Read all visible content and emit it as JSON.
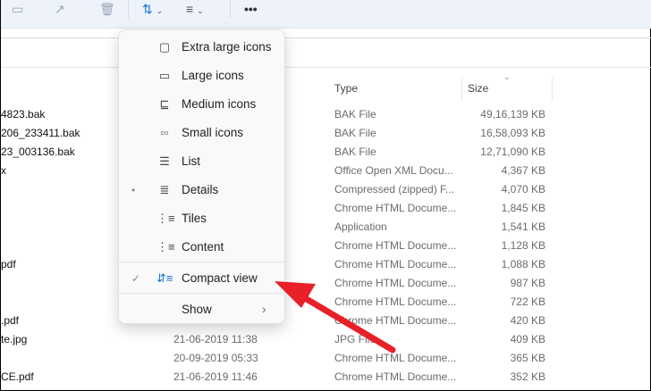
{
  "toolbar": {
    "sort_icon": "sort-icon",
    "view_icon": "view-icon",
    "more_label": "•••"
  },
  "columns": {
    "type": "Type",
    "size": "Size"
  },
  "rows": [
    {
      "name": "4823.bak",
      "date": "",
      "type": "BAK File",
      "size": "49,16,139 KB"
    },
    {
      "name": "206_233411.bak",
      "date": "",
      "type": "BAK File",
      "size": "16,58,093 KB"
    },
    {
      "name": "23_003136.bak",
      "date": "",
      "type": "BAK File",
      "size": "12,71,090 KB"
    },
    {
      "name": "x",
      "date": "",
      "type": "Office Open XML Docu...",
      "size": "4,367 KB"
    },
    {
      "name": "",
      "date": "",
      "type": "Compressed (zipped) F...",
      "size": "4,070 KB"
    },
    {
      "name": "",
      "date": "",
      "type": "Chrome HTML Docume...",
      "size": "1,845 KB"
    },
    {
      "name": "",
      "date": "",
      "type": "Application",
      "size": "1,541 KB"
    },
    {
      "name": "",
      "date": "",
      "type": "Chrome HTML Docume...",
      "size": "1,128 KB"
    },
    {
      "name": "pdf",
      "date": "",
      "type": "Chrome HTML Docume...",
      "size": "1,088 KB"
    },
    {
      "name": "",
      "date": "",
      "type": "Chrome HTML Docume...",
      "size": "987 KB"
    },
    {
      "name": "",
      "date": "",
      "type": "Chrome HTML Docume...",
      "size": "722 KB"
    },
    {
      "name": ".pdf",
      "date": "",
      "type": "Chrome HTML Docume...",
      "size": "420 KB"
    },
    {
      "name": "te.jpg",
      "date": "21-06-2019 11:38",
      "type": "JPG File",
      "size": "409 KB"
    },
    {
      "name": "",
      "date": "20-09-2019 05:33",
      "type": "Chrome HTML Docume...",
      "size": "365 KB"
    },
    {
      "name": "CE.pdf",
      "date": "21-06-2019 11:46",
      "type": "Chrome HTML Docume...",
      "size": "352 KB"
    }
  ],
  "menu": {
    "items": [
      {
        "label": "Extra large icons",
        "icon": "▢"
      },
      {
        "label": "Large icons",
        "icon": "▭"
      },
      {
        "label": "Medium icons",
        "icon": "⊑"
      },
      {
        "label": "Small icons",
        "icon": "▫▫"
      },
      {
        "label": "List",
        "icon": "☰"
      },
      {
        "label": "Details",
        "icon": "≣",
        "mark": "•"
      },
      {
        "label": "Tiles",
        "icon": "⋮≡"
      },
      {
        "label": "Content",
        "icon": "⋮≡"
      }
    ],
    "compact": {
      "label": "Compact view",
      "icon": "⇵≡",
      "mark": "✓"
    },
    "show": {
      "label": "Show",
      "chevron": "›"
    }
  },
  "colors": {
    "arrow": "#e8202a",
    "accent": "#1a73d9"
  }
}
